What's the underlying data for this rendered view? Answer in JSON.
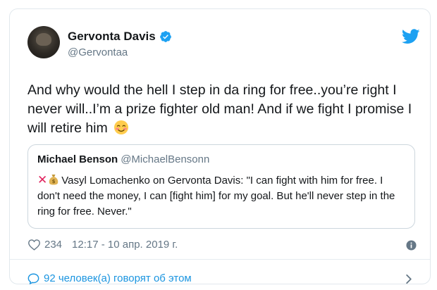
{
  "tweet": {
    "author_name": "Gervonta Davis",
    "author_handle": "@Gervontaa",
    "text": "And why would the hell I step in da ring for free..you’re right I never will..I’m a prize fighter old man! And if we fight I promise I will retire him",
    "likes": "234",
    "timestamp": "12:17 - 10 апр. 2019 г."
  },
  "quoted_tweet": {
    "author_name": "Michael Benson",
    "author_handle": "@MichaelBensonn",
    "text": "Vasyl Lomachenko on Gervonta Davis: \"I can fight with him for free. I don't need the money, I can [fight him] for my goal. But he'll never step in the ring for free. Never.\""
  },
  "footer": {
    "conversation_label": "92 человек(а) говорят об этом"
  },
  "colors": {
    "link_blue": "#1b95e0",
    "verified_blue": "#1da1f2",
    "muted_gray": "#657786",
    "x_red": "#e0245e"
  },
  "icons": [
    "avatar",
    "verified-badge-icon",
    "twitter-bird-icon",
    "blush-emoji-icon",
    "cross-mark-icon",
    "money-bag-icon",
    "heart-icon",
    "info-icon",
    "speech-bubble-icon",
    "chevron-right-icon"
  ]
}
